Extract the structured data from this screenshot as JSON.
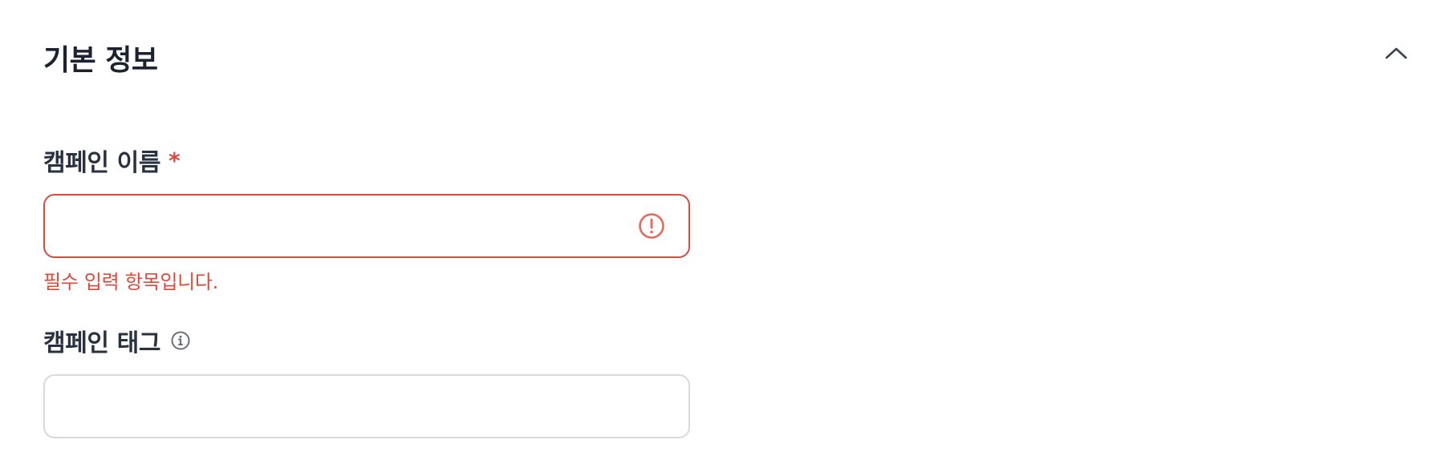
{
  "section": {
    "title": "기본 정보",
    "collapse_icon": "chevron-up-icon"
  },
  "fields": {
    "campaign_name": {
      "label": "캠페인 이름",
      "required_mark": "*",
      "value": "",
      "placeholder": "",
      "error_icon": "alert-circle-icon",
      "error_message": "필수 입력 항목입니다."
    },
    "campaign_tag": {
      "label": "캠페인 태그",
      "info_icon": "info-circle-icon",
      "value": "",
      "placeholder": ""
    }
  },
  "colors": {
    "error": "#e0493a",
    "title_text": "#1c2230",
    "label_text": "#2a3140",
    "border_default": "#d9d9dc",
    "icon_gray": "#6b6f78"
  }
}
